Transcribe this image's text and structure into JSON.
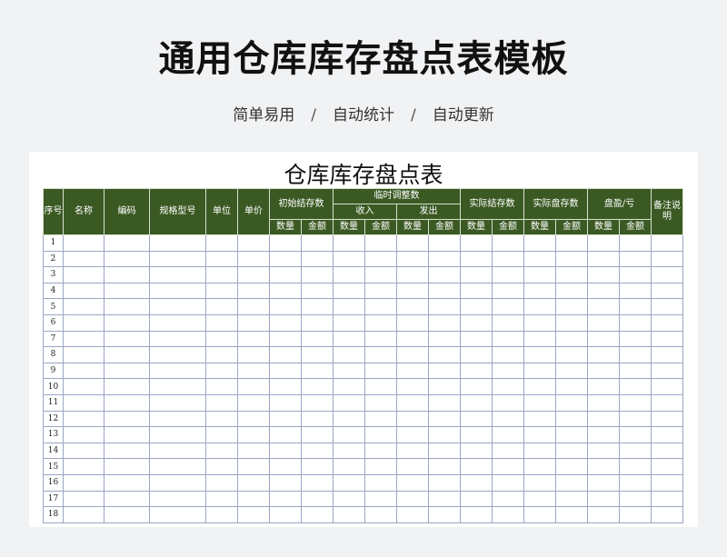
{
  "page": {
    "title": "通用仓库库存盘点表模板",
    "features": [
      "简单易用",
      "自动统计",
      "自动更新"
    ],
    "separator": "/"
  },
  "sheet": {
    "title": "仓库库存盘点表",
    "headers": {
      "seq": "序号",
      "name": "名称",
      "code": "编码",
      "spec": "规格型号",
      "unit": "单位",
      "price": "单价",
      "initial": "初始结存数",
      "temp": "临时调整数",
      "in": "收入",
      "out": "发出",
      "actual_balance": "实际结存数",
      "actual_count": "实际盘存数",
      "profit_loss": "盘盈/亏",
      "remarks": "备注说明",
      "qty": "数量",
      "amount": "金额"
    },
    "rows": [
      "1",
      "2",
      "3",
      "4",
      "5",
      "6",
      "7",
      "8",
      "9",
      "10",
      "11",
      "12",
      "13",
      "14",
      "15",
      "16",
      "17",
      "18"
    ]
  }
}
